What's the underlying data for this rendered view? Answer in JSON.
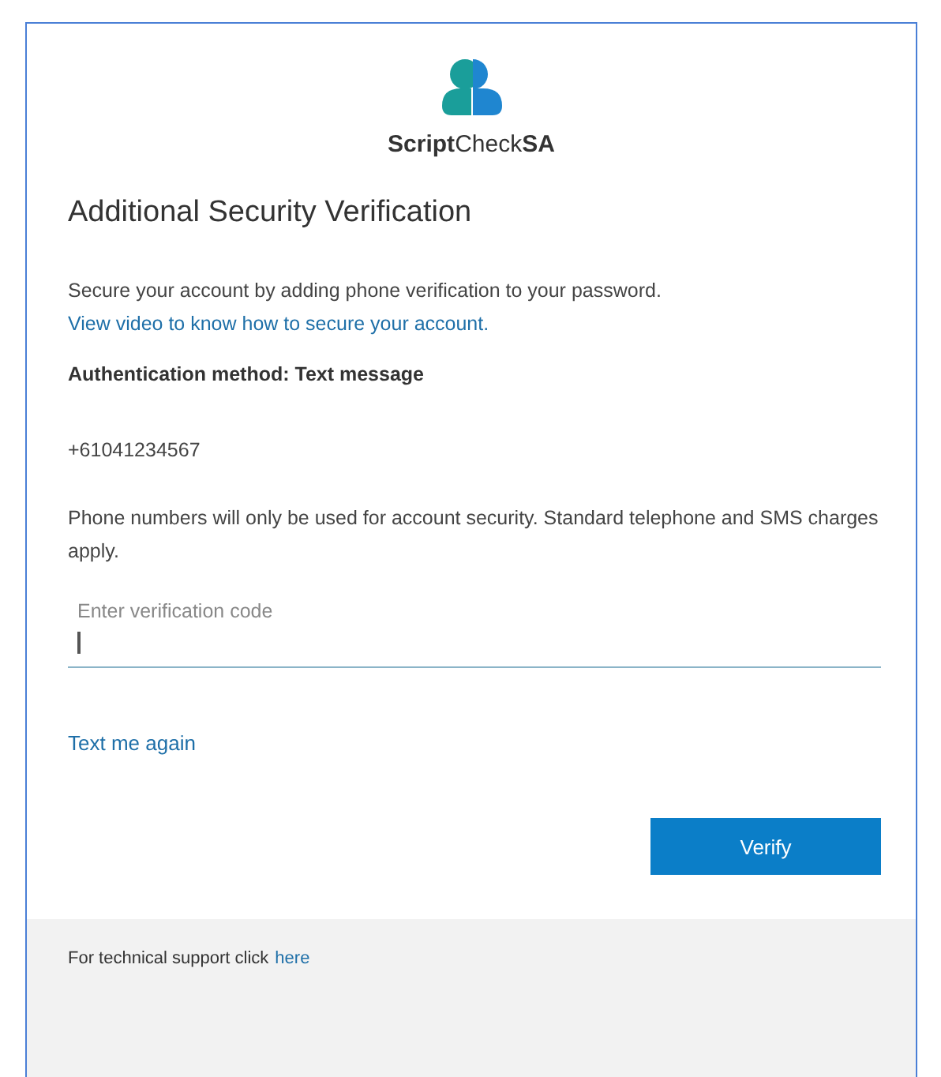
{
  "logo": {
    "text": "**Script**Check**SA**"
  },
  "title": "Additional Security Verification",
  "intro": {
    "text": "Secure your account by adding phone verification to your password.",
    "link": "View video to know how to secure your account."
  },
  "auth_method": "Authentication method: Text message",
  "phone": "+61041234567",
  "notice": "Phone numbers will only be used for account security. Standard telephone and SMS charges apply.",
  "code_field": {
    "placeholder": "Enter verification code"
  },
  "resend_link": "Text me again",
  "verify_button": "Verify",
  "footer": {
    "text": "For technical support click",
    "link": "here"
  }
}
